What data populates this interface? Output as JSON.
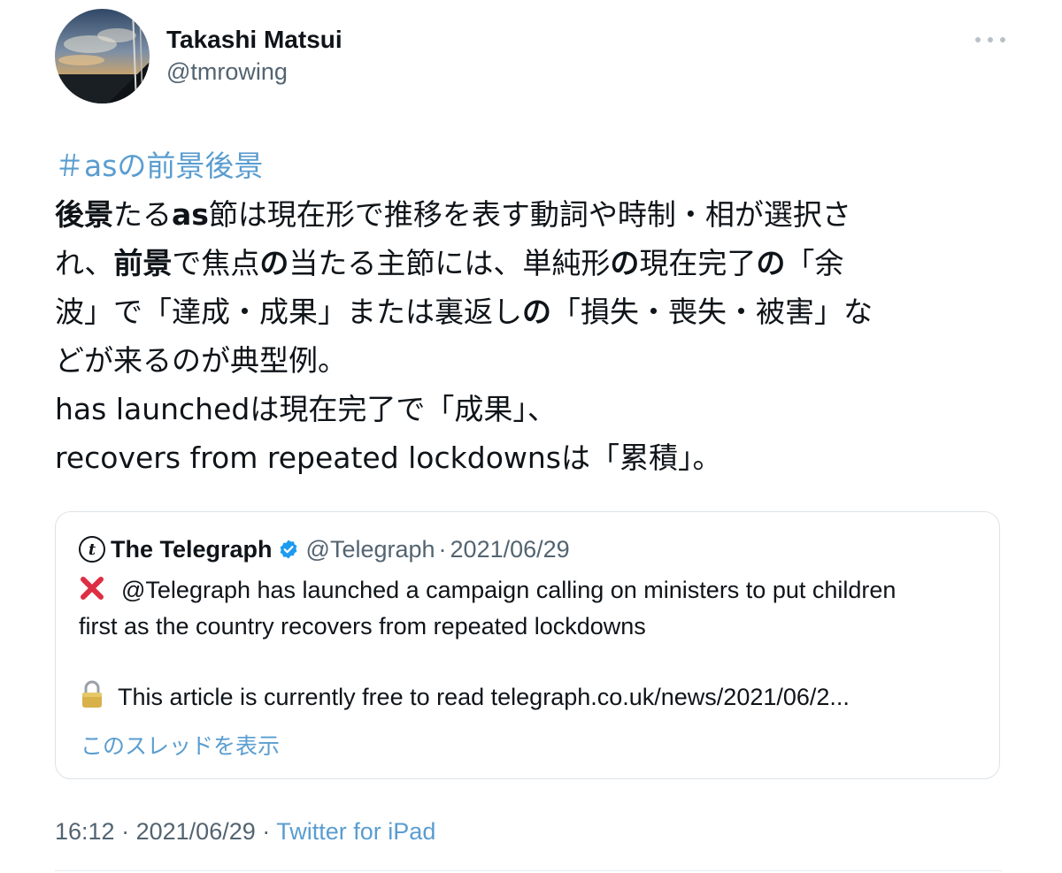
{
  "author": {
    "display_name": "Takashi Matsui",
    "handle": "@tmrowing"
  },
  "tweet": {
    "hashtag": "＃asの前景後景",
    "lines": [
      [
        {
          "t": "後景",
          "b": true
        },
        {
          "t": "たる",
          "b": false
        },
        {
          "t": "as",
          "b": true
        },
        {
          "t": "節は現在形で推移を表す動詞や時制・相が選択さ",
          "b": false
        }
      ],
      [
        {
          "t": "れ、",
          "b": false
        },
        {
          "t": "前景",
          "b": true
        },
        {
          "t": "で焦点",
          "b": false
        },
        {
          "t": "の",
          "b": true
        },
        {
          "t": "当たる主節には、単純形",
          "b": false
        },
        {
          "t": "の",
          "b": true
        },
        {
          "t": "現在完了",
          "b": false
        },
        {
          "t": "の",
          "b": true
        },
        {
          "t": "「余",
          "b": false
        }
      ],
      [
        {
          "t": "波」で「達成・成果」または裏返し",
          "b": false
        },
        {
          "t": "の",
          "b": true
        },
        {
          "t": "「損失・喪失・被害」な",
          "b": false
        }
      ],
      [
        {
          "t": "どが来るのが典型例。",
          "b": false
        }
      ],
      [
        {
          "t": "has launchedは現在完了で「成果」、",
          "b": false
        }
      ],
      [
        {
          "t": "recovers from repeated lockdownsは「累積」。",
          "b": false
        }
      ]
    ]
  },
  "quote": {
    "logo_glyph": "t",
    "name": "The Telegraph",
    "verified": true,
    "handle": "@Telegraph",
    "separator": "·",
    "date": "2021/06/29",
    "body_line1": "@Telegraph has launched a campaign calling on ministers to put children",
    "body_line2": "first as the country recovers from repeated lockdowns",
    "body_line3": "This article is currently free to read  telegraph.co.uk/news/2021/06/2...",
    "show_thread": "このスレッドを表示"
  },
  "meta": {
    "time": "16:12",
    "date": "2021/06/29",
    "separator": "·",
    "source": "Twitter for iPad"
  },
  "colors": {
    "link": "#5a9dd0",
    "secondary_text": "#536471",
    "verified": "#1d9bf0",
    "cross": "#dd2e44"
  },
  "icons": {
    "more": "more-horizontal-icon",
    "verified": "verified-badge-icon",
    "cross": "cross-mark-icon",
    "lock": "lock-icon"
  }
}
